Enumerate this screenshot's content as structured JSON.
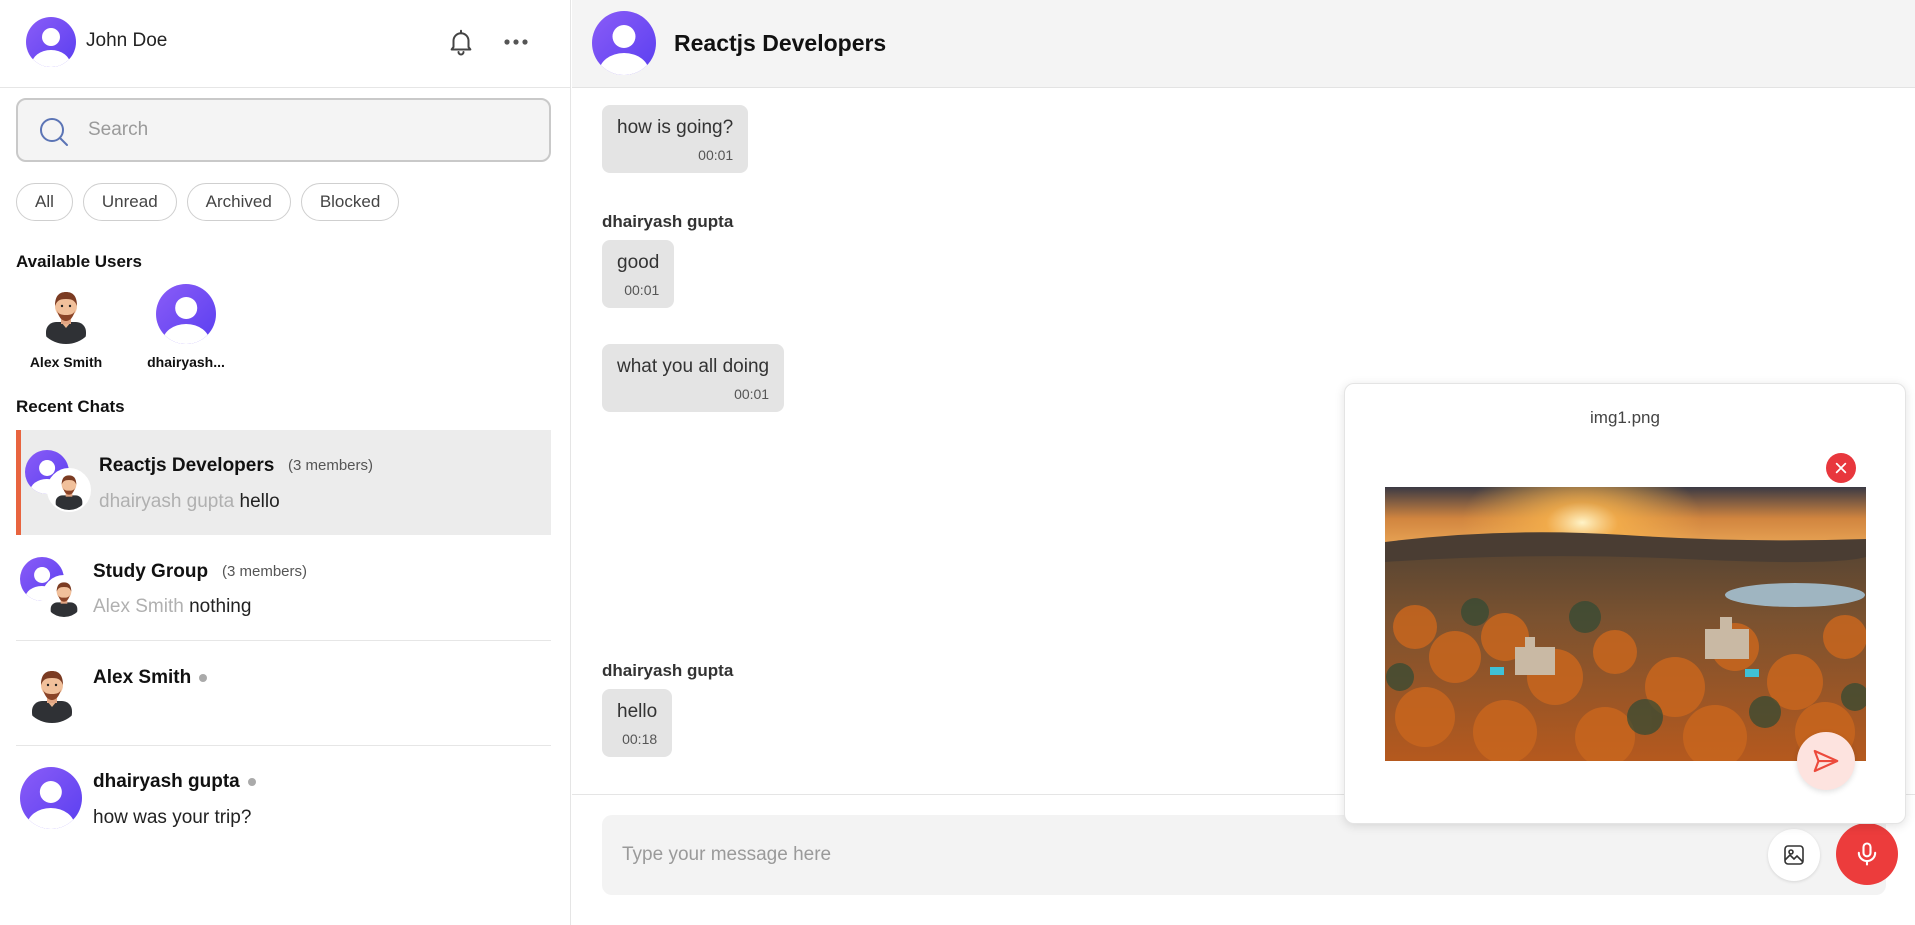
{
  "current_user": {
    "name": "John Doe"
  },
  "search": {
    "placeholder": "Search"
  },
  "filters": [
    "All",
    "Unread",
    "Archived",
    "Blocked"
  ],
  "available_users": {
    "title": "Available Users",
    "users": [
      {
        "name": "Alex Smith",
        "avatar": "cartoon-man"
      },
      {
        "name": "dhairyash...",
        "avatar": "default"
      }
    ]
  },
  "recent_chats": {
    "title": "Recent Chats",
    "items": [
      {
        "name": "Reactjs Developers",
        "members": "(3 members)",
        "preview_sender": "dhairyash gupta",
        "preview_text": "hello",
        "active": true
      },
      {
        "name": "Study Group",
        "members": "(3 members)",
        "preview_sender": "Alex Smith",
        "preview_text": "nothing"
      },
      {
        "name": "Alex Smith",
        "preview_text": ""
      },
      {
        "name": "dhairyash gupta",
        "preview_text": "how was your trip?"
      }
    ]
  },
  "conversation": {
    "title": "Reactjs Developers",
    "messages": [
      {
        "sender": "",
        "text": "how is going?",
        "time": "00:01"
      },
      {
        "sender": "dhairyash gupta",
        "text": "good",
        "time": "00:01"
      },
      {
        "sender": "",
        "text": "what you all doing",
        "time": "00:01"
      },
      {
        "sender": "dhairyash gupta",
        "text": "hello",
        "time": "00:18"
      }
    ]
  },
  "composer": {
    "placeholder": "Type your message here"
  },
  "attachment_preview": {
    "filename": "img1.png"
  },
  "colors": {
    "accent": "#e8643f",
    "mic": "#ec3c3c",
    "avatar": "#6b4ef2"
  }
}
